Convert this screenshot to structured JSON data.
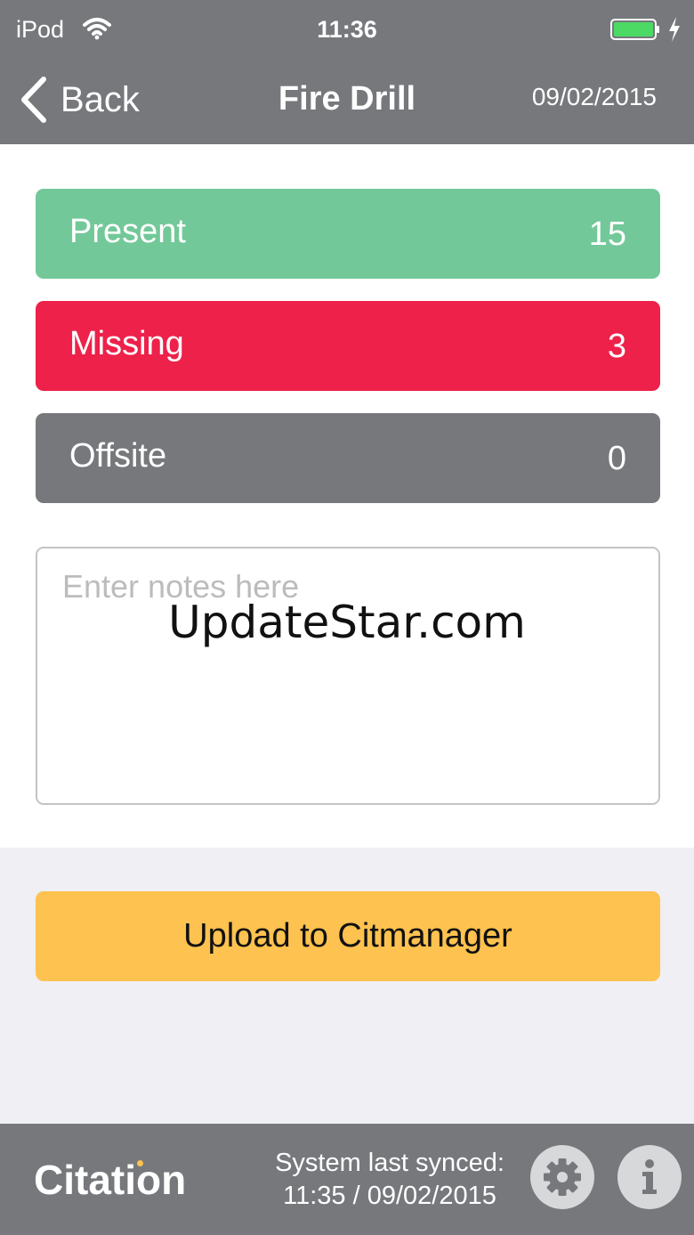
{
  "status_bar": {
    "carrier": "iPod",
    "time": "11:36",
    "wifi_icon": "wifi-icon",
    "battery_icon": "battery-icon",
    "charging_icon": "charging-bolt-icon"
  },
  "nav": {
    "back_label": "Back",
    "title": "Fire Drill",
    "date": "09/02/2015"
  },
  "counts": [
    {
      "label": "Present",
      "count": "15",
      "color": "#73c899"
    },
    {
      "label": "Missing",
      "count": "3",
      "color": "#ed2149"
    },
    {
      "label": "Offsite",
      "count": "0",
      "color": "#76787c"
    }
  ],
  "notes": {
    "placeholder": "Enter notes here",
    "value": ""
  },
  "watermark": "UpdateStar.com",
  "upload_button_label": "Upload to Citmanager",
  "footer": {
    "logo_text": "Citation",
    "logo_dot_color": "#fdc24f",
    "sync_line1": "System last synced:",
    "sync_line2": "11:35 / 09/02/2015",
    "settings_icon": "gear-icon",
    "info_icon": "info-icon"
  },
  "colors": {
    "header_gray": "#76787c",
    "upload_yellow": "#fdc24f",
    "panel_gray": "#efeff4"
  }
}
